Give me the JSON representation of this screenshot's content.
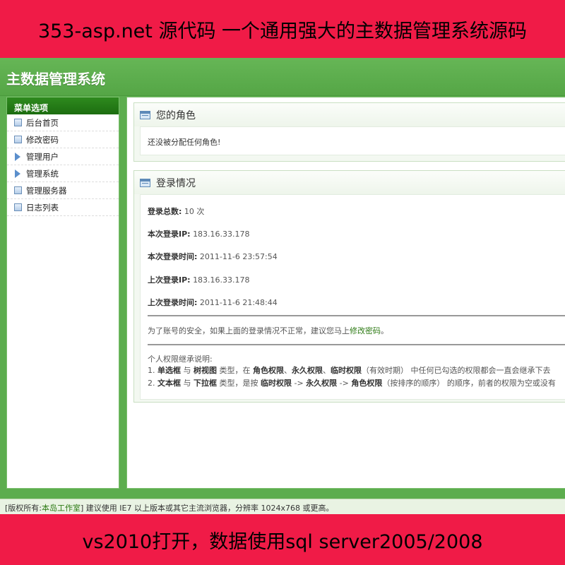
{
  "banner_top": "353-asp.net 源代码 一个通用强大的主数据管理系统源码",
  "banner_bottom": "vs2010打开，数据使用sql server2005/2008",
  "app_title": "主数据管理系统",
  "sidebar": {
    "header": "菜单选项",
    "items": [
      {
        "label": "后台首页",
        "icon": "square-icon"
      },
      {
        "label": "修改密码",
        "icon": "square-icon"
      },
      {
        "label": "管理用户",
        "icon": "triangle-icon"
      },
      {
        "label": "管理系统",
        "icon": "triangle-icon"
      },
      {
        "label": "管理服务器",
        "icon": "square-icon"
      },
      {
        "label": "日志列表",
        "icon": "square-icon"
      }
    ]
  },
  "role_panel": {
    "title": "您的角色",
    "message": "还没被分配任何角色!"
  },
  "login_panel": {
    "title": "登录情况",
    "total_label": "登录总数:",
    "total_value": "10 次",
    "current_ip_label": "本次登录IP:",
    "current_ip_value": "183.16.33.178",
    "current_time_label": "本次登录时间:",
    "current_time_value": "2011-11-6 23:57:54",
    "last_ip_label": "上次登录IP:",
    "last_ip_value": "183.16.33.178",
    "last_time_label": "上次登录时间:",
    "last_time_value": "2011-11-6 21:48:44",
    "security_text": "为了账号的安全，如果上面的登录情况不正常，建议您马上",
    "security_link": "修改密码",
    "security_end": "。",
    "perm_title": "个人权限继承说明:",
    "perm_line1": {
      "num": "1.",
      "a": "单选框",
      "b": " 与 ",
      "c": "树视图",
      "d": " 类型，在 ",
      "e": "角色权限",
      "f": "、",
      "g": "永久权限",
      "h": "、",
      "i": "临时权限",
      "j": "（有效时期） 中任何已勾选的权限都会一直会继承下去"
    },
    "perm_line2": {
      "num": "2.",
      "a": "文本框",
      "b": " 与 ",
      "c": "下拉框",
      "d": " 类型，是按 ",
      "e": "临时权限",
      "f": " -> ",
      "g": "永久权限",
      "h": " -> ",
      "i": "角色权限",
      "j": "（按排序的顺序） 的顺序，前者的权限为空或没有"
    }
  },
  "footer": {
    "prefix": "[版权所有:",
    "author": "本岛工作室",
    "suffix": "] 建议使用 IE7 以上版本或其它主流浏览器，分辨率 1024x768 或更高。"
  },
  "colors": {
    "banner": "#f01b47",
    "app_green": "#5cad4e",
    "sidebar_header": "#1c6d10",
    "link": "#2d7a14"
  }
}
